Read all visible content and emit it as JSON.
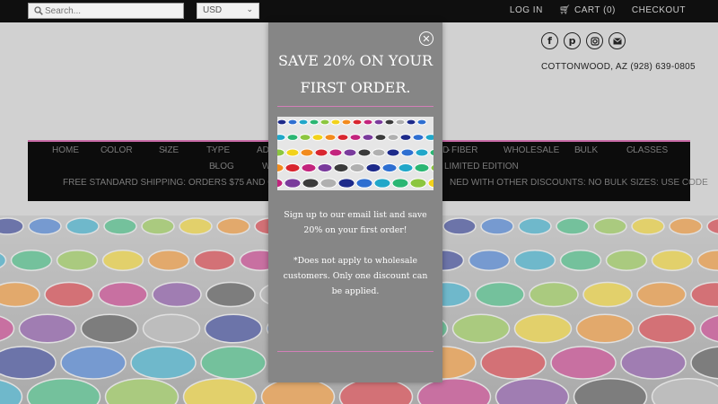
{
  "topbar": {
    "search_placeholder": "Search...",
    "currency": "USD",
    "login": "LOG IN",
    "cart": "CART (0)",
    "checkout": "CHECKOUT"
  },
  "header": {
    "phone": "COTTONWOOD, AZ (928) 639-0805",
    "socials": [
      "facebook-icon",
      "pinterest-icon",
      "instagram-icon",
      "mail-icon"
    ]
  },
  "nav": {
    "row1": [
      "HOME",
      "COLOR",
      "SIZE",
      "TYPE",
      "AD",
      "D FIBER",
      "WHOLESALE",
      "BULK",
      "CLASSES"
    ],
    "row2": [
      "BLOG",
      "W",
      "LIMITED EDITION"
    ],
    "banner_left": "FREE STANDARD SHIPPING: ORDERS $75 AND OVER: DC",
    "banner_right": "NED WITH OTHER DISCOUNTS: NO BULK SIZES: USE CODE"
  },
  "modal": {
    "title_line1": "SAVE 20% ON YOUR",
    "title_line2": "FIRST ORDER.",
    "body1": "Sign up to our email list and save 20% on your first order!",
    "body2": "*Does not apply to wholesale customers. Only one discount can be applied.",
    "close": "✕"
  }
}
